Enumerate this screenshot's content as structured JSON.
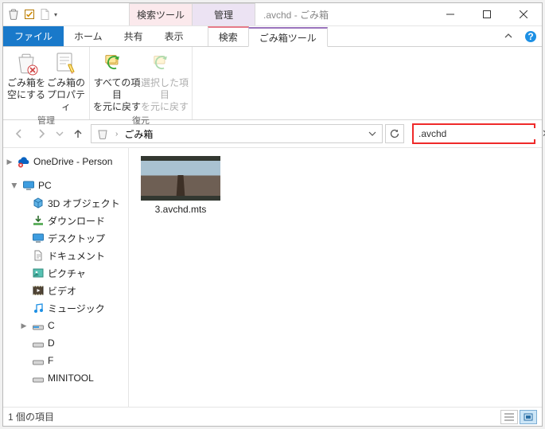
{
  "titlebar": {
    "context_tab_search": "検索ツール",
    "context_tab_manage": "管理",
    "window_title": ".avchd - ごみ箱"
  },
  "tabs": {
    "file": "ファイル",
    "home": "ホーム",
    "share": "共有",
    "view": "表示",
    "search": "検索",
    "recycle": "ごみ箱ツール"
  },
  "ribbon": {
    "group_manage": "管理",
    "group_restore": "復元",
    "empty_label_l1": "ごみ箱を",
    "empty_label_l2": "空にする",
    "props_label_l1": "ごみ箱の",
    "props_label_l2": "プロパティ",
    "restore_all_l1": "すべての項目",
    "restore_all_l2": "を元に戻す",
    "restore_sel_l1": "選択した項目",
    "restore_sel_l2": "を元に戻す"
  },
  "breadcrumb": {
    "location": "ごみ箱"
  },
  "search": {
    "value": ".avchd"
  },
  "sidebar": {
    "onedrive": "OneDrive - Person",
    "pc": "PC",
    "items": [
      "3D オブジェクト",
      "ダウンロード",
      "デスクトップ",
      "ドキュメント",
      "ピクチャ",
      "ビデオ",
      "ミュージック",
      "C",
      "D",
      "F",
      "MINITOOL"
    ]
  },
  "files": {
    "result": "3.avchd.mts"
  },
  "statusbar": {
    "count": "1 個の項目"
  }
}
